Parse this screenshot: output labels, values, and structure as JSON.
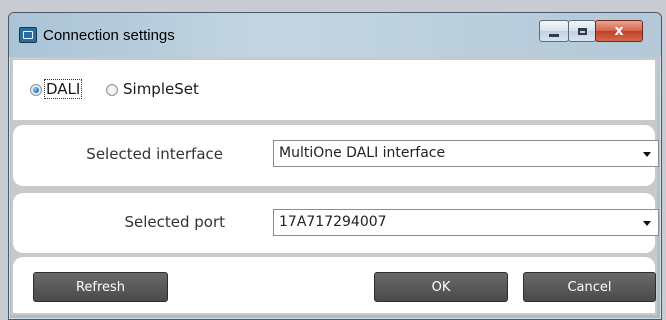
{
  "window": {
    "title": "Connection settings",
    "icon": "app-window-icon",
    "controls": {
      "minimize": "minimize-icon",
      "maximize": "maximize-icon",
      "close": "x"
    }
  },
  "mode": {
    "options": [
      {
        "label": "DALI",
        "checked": true
      },
      {
        "label": "SimpleSet",
        "checked": false
      }
    ]
  },
  "interface": {
    "label": "Selected interface",
    "value": "MultiOne DALI interface"
  },
  "port": {
    "label": "Selected port",
    "value": "17A717294007"
  },
  "buttons": {
    "refresh": "Refresh",
    "ok": "OK",
    "cancel": "Cancel"
  },
  "colors": {
    "accent": "#1a6fb7",
    "button_bg": "#4a4a4a",
    "panel_bg": "#ffffff",
    "separator_bg": "#c9c9c9"
  }
}
